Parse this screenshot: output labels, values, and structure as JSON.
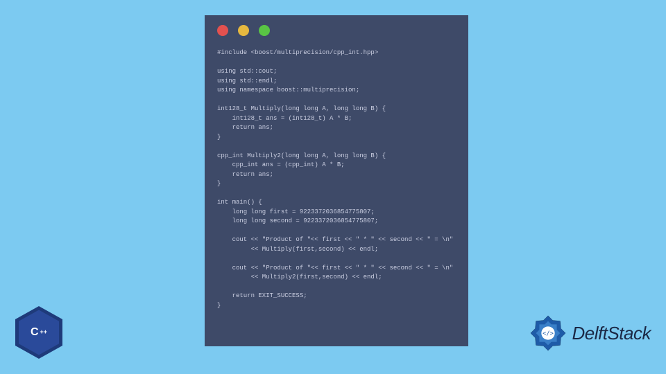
{
  "code": {
    "content": "#include <boost/multiprecision/cpp_int.hpp>\n\nusing std::cout;\nusing std::endl;\nusing namespace boost::multiprecision;\n\nint128_t Multiply(long long A, long long B) {\n    int128_t ans = (int128_t) A * B;\n    return ans;\n}\n\ncpp_int Multiply2(long long A, long long B) {\n    cpp_int ans = (cpp_int) A * B;\n    return ans;\n}\n\nint main() {\n    long long first = 9223372036854775807;\n    long long second = 9223372036854775807;\n\n    cout << \"Product of \"<< first << \" * \" << second << \" = \\n\"\n         << Multiply(first,second) << endl;\n\n    cout << \"Product of \"<< first << \" * \" << second << \" = \\n\"\n         << Multiply2(first,second) << endl;\n\n    return EXIT_SUCCESS;\n}"
  },
  "cpp_badge": {
    "letter": "C",
    "plus": "++"
  },
  "brand": {
    "name": "DelftStack"
  }
}
